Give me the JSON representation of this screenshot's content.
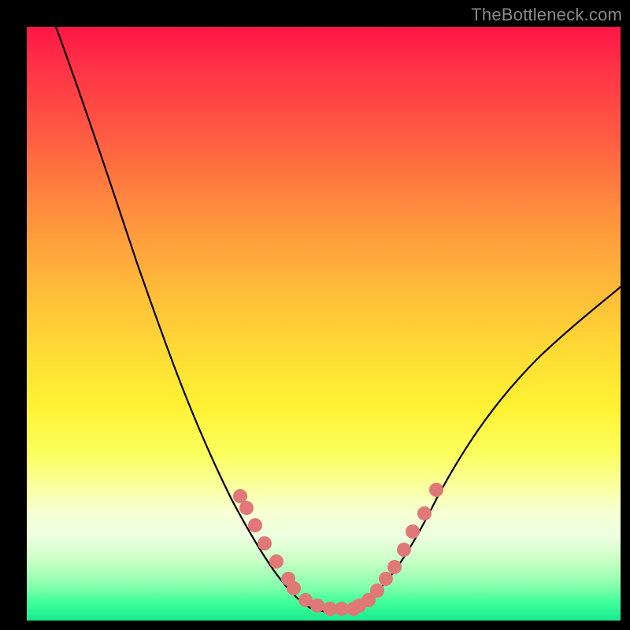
{
  "watermark": "TheBottleneck.com",
  "colors": {
    "frame": "#000000",
    "curve": "#000000",
    "dot": "#e07878",
    "gradient_top": "#ff1647",
    "gradient_bottom": "#18e98e"
  },
  "chart_data": {
    "type": "line",
    "title": "",
    "xlabel": "",
    "ylabel": "",
    "xlim": [
      0,
      100
    ],
    "ylim": [
      0,
      100
    ],
    "x": [
      5,
      10,
      15,
      20,
      25,
      30,
      35,
      38,
      40,
      42,
      44,
      46,
      48,
      50,
      52,
      54,
      55,
      58,
      62,
      66,
      70,
      75,
      80,
      85,
      90,
      95,
      100
    ],
    "values": [
      100,
      86,
      71,
      57,
      44,
      33,
      23,
      17,
      13,
      10,
      7,
      5,
      3,
      2,
      2,
      2,
      2,
      4,
      8,
      14,
      20,
      28,
      36,
      43,
      49,
      54,
      58
    ],
    "series": [
      {
        "name": "bottleneck-curve",
        "x": [
          5,
          10,
          15,
          20,
          25,
          30,
          35,
          38,
          40,
          42,
          44,
          46,
          48,
          50,
          52,
          54,
          55,
          58,
          62,
          66,
          70,
          75,
          80,
          85,
          90,
          95,
          100
        ],
        "y": [
          100,
          86,
          71,
          57,
          44,
          33,
          23,
          17,
          13,
          10,
          7,
          5,
          3,
          2,
          2,
          2,
          2,
          4,
          8,
          14,
          20,
          28,
          36,
          43,
          49,
          54,
          58
        ]
      },
      {
        "name": "highlight-dots",
        "x": [
          36,
          37,
          38.5,
          40,
          42,
          44,
          45,
          47,
          49,
          51,
          53,
          55,
          56,
          57.5,
          59,
          60.5,
          62,
          63.5,
          65,
          67,
          69
        ],
        "y": [
          21,
          19,
          16,
          13,
          10,
          7,
          5.5,
          3.5,
          2.5,
          2,
          2,
          2,
          2.5,
          3.5,
          5,
          7,
          9,
          12,
          15,
          18,
          22
        ]
      }
    ],
    "annotations": []
  }
}
